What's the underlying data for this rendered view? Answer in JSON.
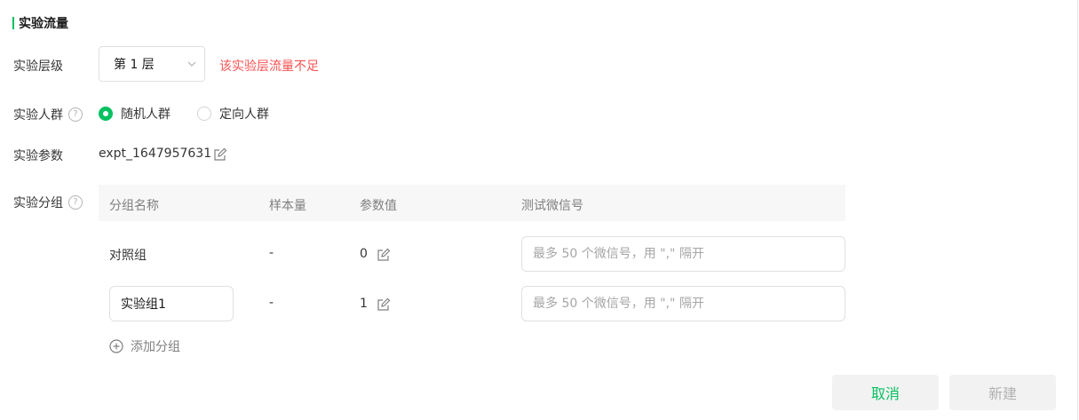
{
  "section": {
    "title": "实验流量"
  },
  "layer": {
    "label": "实验层级",
    "selected": "第 1 层",
    "warning": "该实验层流量不足"
  },
  "crowd": {
    "label": "实验人群",
    "options": [
      {
        "label": "随机人群",
        "checked": true
      },
      {
        "label": "定向人群",
        "checked": false
      }
    ]
  },
  "param": {
    "label": "实验参数",
    "value": "expt_1647957631"
  },
  "groups": {
    "label": "实验分组",
    "columns": [
      "分组名称",
      "样本量",
      "参数值",
      "测试微信号"
    ],
    "rows": [
      {
        "name": "对照组",
        "sample": "-",
        "param_value": "0",
        "wechat_placeholder": "最多 50 个微信号，用 \",\" 隔开"
      },
      {
        "name": "实验组1",
        "sample": "-",
        "param_value": "1",
        "wechat_placeholder": "最多 50 个微信号，用 \",\" 隔开"
      }
    ],
    "add_label": "添加分组"
  },
  "actions": {
    "cancel": "取消",
    "create": "新建"
  },
  "colors": {
    "accent": "#07c160",
    "warning": "#fa5151"
  },
  "icons": {
    "help": "question-circle-icon",
    "edit": "edit-icon",
    "chevron": "chevron-down-icon",
    "add": "plus-circle-icon"
  }
}
